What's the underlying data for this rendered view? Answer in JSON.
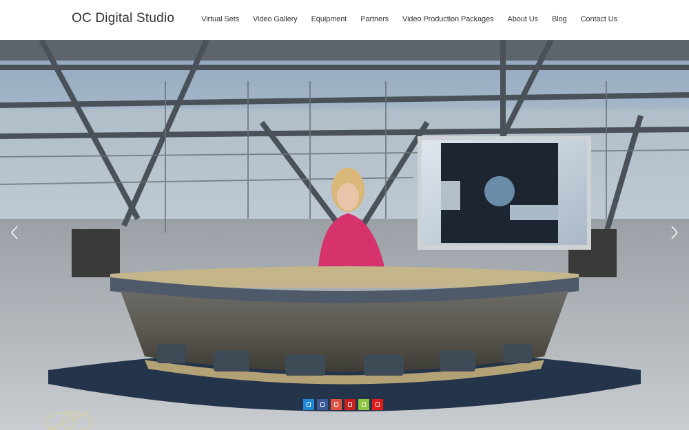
{
  "site": {
    "title": "OC Digital Studio"
  },
  "nav": {
    "items": [
      {
        "label": "Virtual Sets",
        "name": "nav-virtual-sets"
      },
      {
        "label": "Video Gallery",
        "name": "nav-video-gallery"
      },
      {
        "label": "Equipment",
        "name": "nav-equipment"
      },
      {
        "label": "Partners",
        "name": "nav-partners"
      },
      {
        "label": "Video Production Packages",
        "name": "nav-video-production-packages"
      },
      {
        "label": "About Us",
        "name": "nav-about-us"
      },
      {
        "label": "Blog",
        "name": "nav-blog"
      },
      {
        "label": "Contact Us",
        "name": "nav-contact-us"
      }
    ]
  },
  "slider": {
    "prev_icon": "chevron-left-icon",
    "next_icon": "chevron-right-icon",
    "dots": [
      {
        "color": "#1e88d8"
      },
      {
        "color": "#3b5998"
      },
      {
        "color": "#e0523f"
      },
      {
        "color": "#cc1f1f"
      },
      {
        "color": "#8cc63f"
      },
      {
        "color": "#e21b1b"
      }
    ]
  },
  "colors": {
    "header_bg": "#ffffff",
    "text": "#333333"
  }
}
